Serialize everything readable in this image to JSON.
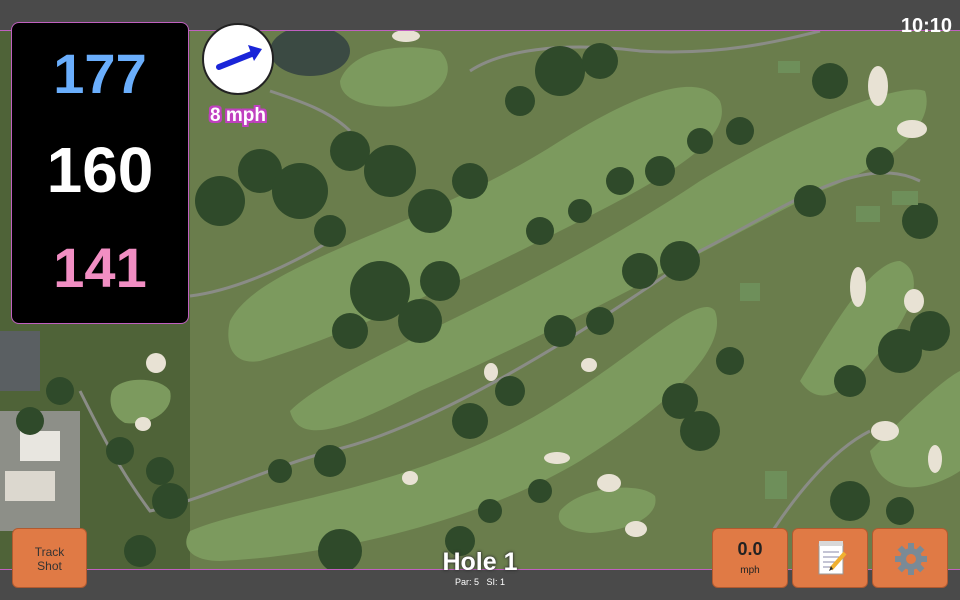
{
  "status": {
    "clock": "10:10"
  },
  "distances": {
    "back": "177",
    "center": "160",
    "front": "141"
  },
  "wind": {
    "speed": "8 mph",
    "direction_icon": "arrow-icon"
  },
  "hole": {
    "title": "Hole 1",
    "par_label": "Par: 5",
    "si_label": "SI: 1"
  },
  "buttons": {
    "track_shot_line1": "Track",
    "track_shot_line2": "Shot",
    "speed_value": "0.0",
    "speed_unit": "mph",
    "notes_icon": "notepad-icon",
    "settings_icon": "gear-icon"
  },
  "colors": {
    "back_distance": "#6aaefc",
    "center_distance": "#ffffff",
    "front_distance": "#f18ec3",
    "button_orange": "#e07a45"
  }
}
